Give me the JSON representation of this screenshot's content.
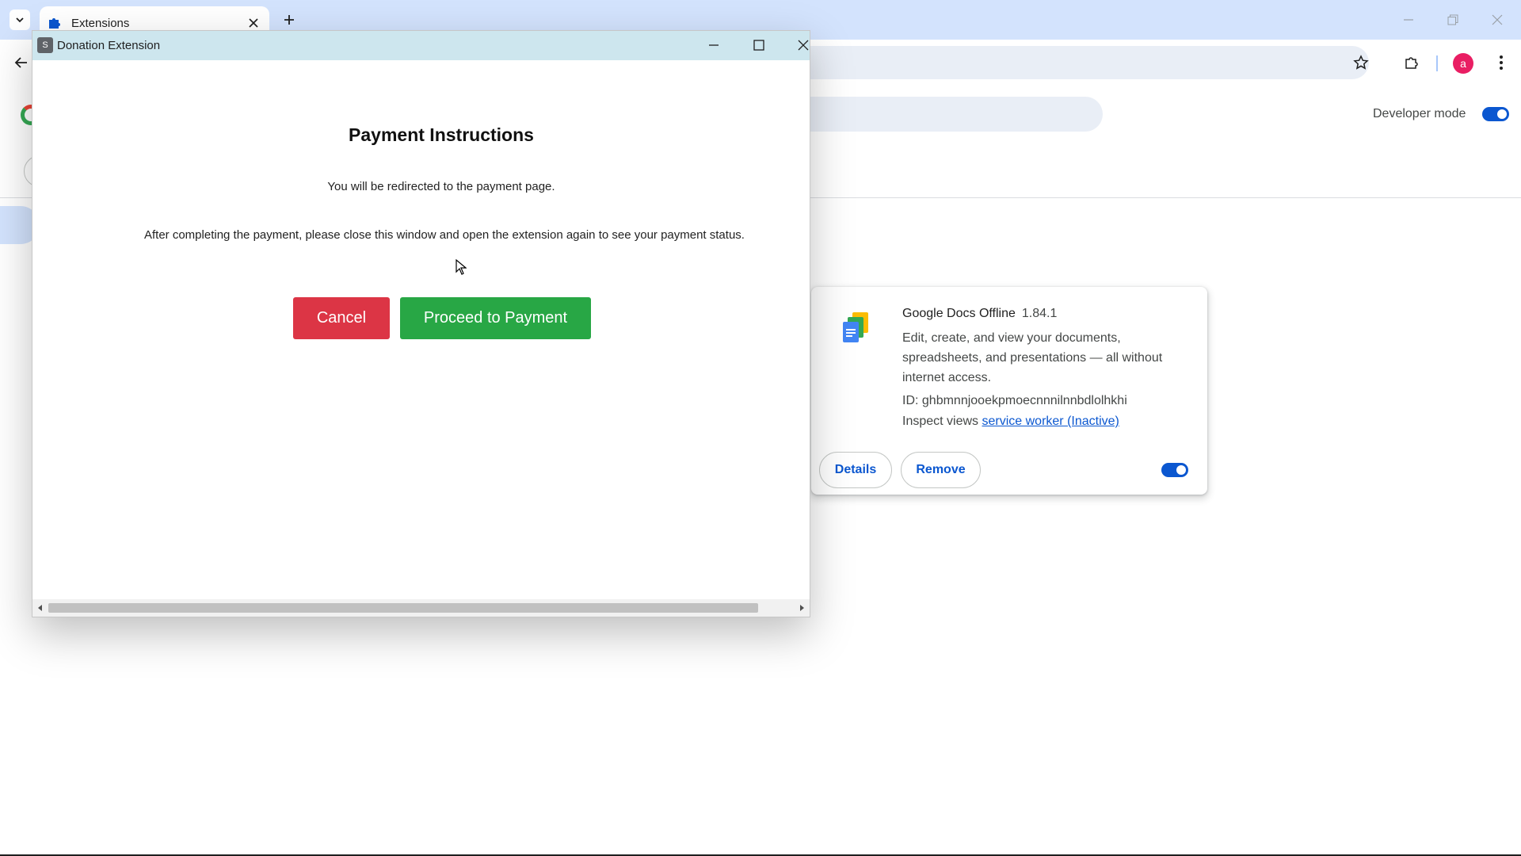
{
  "browser": {
    "tab_title": "Extensions",
    "icons": {
      "tab_search": "chevron-down-icon",
      "tab_favicon": "puzzle-icon",
      "tab_close": "close-icon",
      "new_tab": "plus-icon",
      "back": "back-arrow-icon",
      "bookmark": "star-icon",
      "extensions": "puzzle-icon",
      "menu": "kebab-menu-icon"
    },
    "profile_initial": "a"
  },
  "extensions_page": {
    "developer_mode_label": "Developer mode",
    "developer_mode_on": true,
    "card": {
      "name": "Google Docs Offline",
      "version": "1.84.1",
      "description": "Edit, create, and view your documents, spreadsheets, and presentations — all without internet access.",
      "id_text": "ID: ghbmnnjooekpmoecnnnilnnbdlolhkhi",
      "inspect_label": "Inspect views",
      "inspect_link": "service worker (Inactive)",
      "details_label": "Details",
      "remove_label": "Remove",
      "enabled": true
    }
  },
  "popup": {
    "app_icon_letter": "S",
    "title": "Donation Extension",
    "heading": "Payment Instructions",
    "redirect_text": "You will be redirected to the payment page.",
    "after_text": "After completing the payment, please close this window and open the extension again to see your payment status.",
    "cancel_label": "Cancel",
    "proceed_label": "Proceed to Payment",
    "colors": {
      "titlebar": "#cde6ee",
      "cancel": "#dc3545",
      "proceed": "#28a745"
    }
  }
}
